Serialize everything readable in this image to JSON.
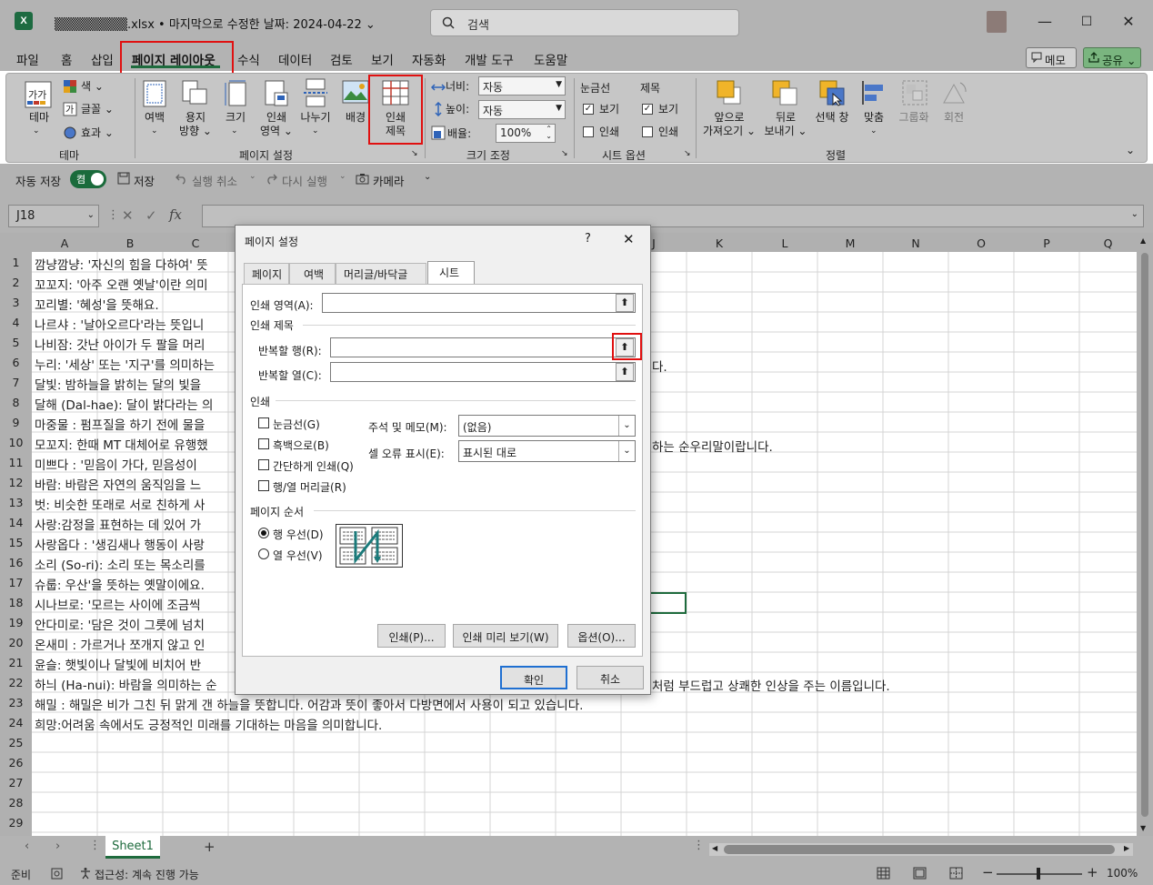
{
  "app": {
    "title": "▒▒▒▒▒▒▒▒.xlsx • 마지막으로 수정한 날짜: 2024-04-22 ⌄",
    "search_placeholder": "검색",
    "excel_icon_letter": "X",
    "window_controls": [
      "—",
      "☐",
      "✕"
    ]
  },
  "menu": {
    "tabs": [
      "파일",
      "홈",
      "삽입",
      "페이지 레이아웃",
      "수식",
      "데이터",
      "검토",
      "보기",
      "자동화",
      "개발 도구",
      "도움말"
    ],
    "memo": "메모",
    "share": "공유 ⌄"
  },
  "ribbon": {
    "theme": {
      "theme_btn": "테마",
      "colors": "색 ⌄",
      "fonts": "글꼴 ⌄",
      "effects": "효과 ⌄",
      "group": "테마"
    },
    "page_setup": {
      "margins": "여백",
      "orientation": "용지\n방향 ⌄",
      "size": "크기",
      "print_area": "인쇄\n영역 ⌄",
      "breaks": "나누기",
      "background": "배경",
      "print_titles": "인쇄\n제목",
      "group": "페이지 설정"
    },
    "scale": {
      "width_label": "너비:",
      "width_value": "자동",
      "height_label": "높이:",
      "height_value": "자동",
      "scale_label": "배율:",
      "scale_value": "100%",
      "group": "크기 조정"
    },
    "sheet_options": {
      "gridlines": "눈금선",
      "headings": "제목",
      "view": "보기",
      "print": "인쇄",
      "group": "시트 옵션"
    },
    "arrange": {
      "bring_forward": "앞으로\n가져오기 ⌄",
      "send_backward": "뒤로\n보내기 ⌄",
      "selection_pane": "선택 창",
      "align": "맞춤",
      "group_btn": "그룹화",
      "rotate": "회전",
      "group": "정렬"
    }
  },
  "qat": {
    "autosave": "자동 저장",
    "toggle": "켬",
    "save": "저장",
    "undo": "실행 취소",
    "redo": "다시 실행",
    "camera": "카메라"
  },
  "formula_bar": {
    "name_box": "J18",
    "fx": "fx"
  },
  "columns": [
    "A",
    "B",
    "C",
    "",
    "",
    "",
    "",
    "",
    "",
    "J",
    "K",
    "L",
    "M",
    "N",
    "O",
    "P",
    "Q"
  ],
  "rows": [
    {
      "n": "1",
      "text": "깜냥깜냥: '자신의 힘을 다하여' 뜻"
    },
    {
      "n": "2",
      "text": "꼬꼬지: '아주 오랜 옛날'이란 의미"
    },
    {
      "n": "3",
      "text": "꼬리별: '혜성'을 뜻해요."
    },
    {
      "n": "4",
      "text": "나르샤 :  '날아오르다'라는 뜻입니"
    },
    {
      "n": "5",
      "text": "나비잠: 갓난 아이가 두 팔을 머리"
    },
    {
      "n": "6",
      "text": "누리: '세상' 또는 '지구'를 의미하는"
    },
    {
      "n": "7",
      "text": "달빛: 밤하늘을 밝히는 달의 빛을"
    },
    {
      "n": "8",
      "text": "달해 (Dal-hae): 달이 밝다라는 의"
    },
    {
      "n": "9",
      "text": "마중물 :  펌프질을 하기 전에 물을"
    },
    {
      "n": "10",
      "text": "모꼬지: 한때 MT 대체어로 유행했"
    },
    {
      "n": "11",
      "text": "미쁘다 :  '믿음이 가다, 믿음성이 "
    },
    {
      "n": "12",
      "text": "바람: 바람은 자연의 움직임을 느"
    },
    {
      "n": "13",
      "text": "벗: 비슷한 또래로 서로 친하게 사"
    },
    {
      "n": "14",
      "text": "사랑:감정을 표현하는 데 있어 가"
    },
    {
      "n": "15",
      "text": "사랑옵다 :  '생김새나 행동이 사랑"
    },
    {
      "n": "16",
      "text": "소리 (So-ri): 소리 또는 목소리를 "
    },
    {
      "n": "17",
      "text": "슈룹: 우산'을 뜻하는 옛말이에요."
    },
    {
      "n": "18",
      "text": "시나브로: '모르는 사이에 조금씩"
    },
    {
      "n": "19",
      "text": "안다미로: '담은 것이 그릇에 넘치"
    },
    {
      "n": "20",
      "text": "온새미 :  가르거나 쪼개지 않고 인"
    },
    {
      "n": "21",
      "text": "윤슬: 햇빛이나 달빛에 비치어 반"
    },
    {
      "n": "22",
      "text": "하늬 (Ha-nui): 바람을 의미하는 순"
    },
    {
      "n": "23",
      "text": "해밀 :  해밀은 비가 그친 뒤 맑게 갠 하늘을 뜻합니다. 어감과 뜻이 좋아서 다방면에서 사용이 되고 있습니다."
    },
    {
      "n": "24",
      "text": "희망:어려움 속에서도 긍정적인 미래를 기대하는 마음을 의미합니다."
    },
    {
      "n": "25",
      "text": ""
    },
    {
      "n": "26",
      "text": ""
    },
    {
      "n": "27",
      "text": ""
    },
    {
      "n": "28",
      "text": ""
    },
    {
      "n": "29",
      "text": ""
    }
  ],
  "overflow_text": {
    "row6": "다.",
    "row10": "하는 순우리말이랍니다.",
    "row22": "처럼 부드럽고 상쾌한 인상을 주는 이름입니다."
  },
  "sheet_tabs": {
    "active": "Sheet1",
    "add": "+"
  },
  "status": {
    "ready": "준비",
    "accessibility": "접근성: 계속 진행 가능",
    "zoom": "100%"
  },
  "dialog": {
    "title": "페이지 설정",
    "help": "?",
    "close": "✕",
    "tabs": [
      "페이지",
      "여백",
      "머리글/바닥글",
      "시트"
    ],
    "print_area_label": "인쇄 영역(A):",
    "print_titles_section": "인쇄 제목",
    "rows_repeat_label": "반복할 행(R):",
    "cols_repeat_label": "반복할 열(C):",
    "print_section": "인쇄",
    "gridlines": "눈금선(G)",
    "black_white": "흑백으로(B)",
    "draft": "간단하게 인쇄(Q)",
    "row_col_headings": "행/열 머리글(R)",
    "comments_label": "주석 및 메모(M):",
    "comments_value": "(없음)",
    "errors_label": "셀 오류 표시(E):",
    "errors_value": "표시된 대로",
    "page_order_section": "페이지 순서",
    "down_then_over": "행 우선(D)",
    "over_then_down": "열 우선(V)",
    "print_btn": "인쇄(P)...",
    "preview_btn": "인쇄 미리 보기(W)",
    "options_btn": "옵션(O)...",
    "ok": "확인",
    "cancel": "취소",
    "collapse_glyph": "⬆"
  }
}
